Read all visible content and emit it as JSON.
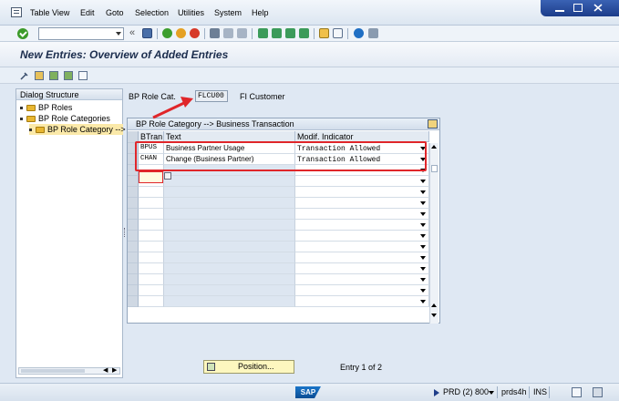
{
  "menu": {
    "items": [
      "Table View",
      "Edit",
      "Goto",
      "Selection",
      "Utilities",
      "System",
      "Help"
    ]
  },
  "toolbar": {
    "command_field_value": "",
    "icons": [
      "enter-icon",
      "save-icon",
      "back-icon",
      "exit-icon",
      "cancel-icon",
      "print-icon",
      "find-icon",
      "find-next-icon",
      "first-page-icon",
      "previous-page-icon",
      "next-page-icon",
      "last-page-icon",
      "new-session-icon",
      "shortcut-icon",
      "help-icon",
      "customize-layout-icon"
    ]
  },
  "title": "New Entries: Overview of Added Entries",
  "dialog_structure": {
    "header": "Dialog Structure",
    "items": [
      {
        "label": "BP Roles",
        "level": 0,
        "selected": false
      },
      {
        "label": "BP Role Categories",
        "level": 0,
        "selected": false
      },
      {
        "label": "BP Role Category -->",
        "level": 1,
        "selected": true
      }
    ]
  },
  "header_field": {
    "label": "BP Role Cat.",
    "value": "FLCU00",
    "description": "FI Customer"
  },
  "table": {
    "title": "BP Role Category --> Business Transaction",
    "columns": [
      "BTran",
      "Text",
      "Modif. Indicator"
    ],
    "rows": [
      {
        "btran": "BPUS",
        "text": "Business Partner Usage",
        "modif": "Transaction Allowed"
      },
      {
        "btran": "CHAN",
        "text": "Change (Business Partner)",
        "modif": "Transaction Allowed"
      }
    ],
    "empty_rows": 13
  },
  "position_button": {
    "label": "Position..."
  },
  "entry_info": "Entry 1 of 2",
  "status_bar": {
    "logo": "SAP",
    "system": "PRD (2) 800",
    "server": "prds4h",
    "mode": "INS"
  },
  "colors": {
    "highlight": "#e0262a",
    "title_text": "#1b2d4d",
    "selected_tree_item": "#fbe9a9",
    "position_button": "#fdf7bf"
  }
}
